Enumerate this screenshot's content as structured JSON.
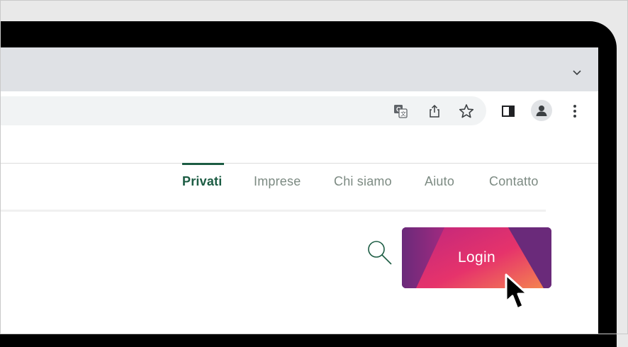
{
  "browser": {
    "tab_strip": {
      "chevron_icon": "chevron-down-icon"
    },
    "toolbar": {
      "icons": [
        "translate-icon",
        "share-icon",
        "bookmark-star-icon",
        "side-panel-icon",
        "profile-avatar-icon",
        "more-menu-icon"
      ]
    }
  },
  "site": {
    "nav": {
      "items": [
        {
          "label": "Privati",
          "active": true
        },
        {
          "label": "Imprese",
          "active": false
        },
        {
          "label": "Chi siamo",
          "active": false
        },
        {
          "label": "Aiuto",
          "active": false
        },
        {
          "label": "Contatto",
          "active": false
        }
      ]
    },
    "login_label": "Login"
  },
  "colors": {
    "nav_active": "#1c5c43",
    "nav_inactive": "#7c8a82",
    "login_purple": "#6a2a7a",
    "login_magenta": "#d6296e",
    "login_orange": "#f06b4f"
  }
}
